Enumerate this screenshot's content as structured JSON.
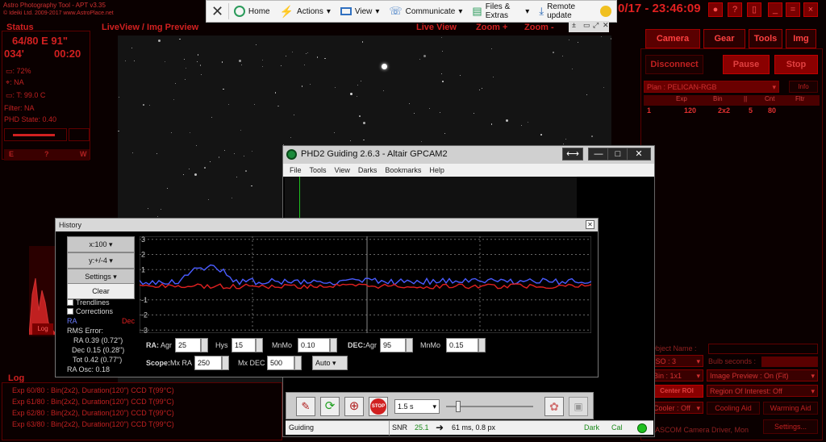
{
  "apt": {
    "title_line1": "Astro Photography Tool  -  APT v3.35",
    "title_line2": "© Ideiki Ltd. 2009-2017  www.AstroPlace.net",
    "clock": "0/17 - 23:46:09",
    "status": {
      "header": "Status",
      "exposure": "64/80 E  91\"",
      "angle": "034'",
      "time": "00:20",
      "battery": ": 72%",
      "focus": ": NA",
      "temp": ": T: 99.0 C",
      "filter": "Filter: NA",
      "phd_state": "PHD State: 0.40",
      "dir_e": "E",
      "dir_q": "?",
      "dir_w": "W"
    },
    "liveview": {
      "header": "LiveView / Img Preview",
      "live_view": "Live View",
      "zoom_in": "Zoom +",
      "zoom_out": "Zoom -"
    },
    "tabs": [
      "Camera",
      "Gear",
      "Tools",
      "Img"
    ],
    "buttons": {
      "disconnect": "Disconnect",
      "pause": "Pause",
      "stop": "Stop"
    },
    "plan": {
      "name": "Plan : PELICAN-RGB",
      "info": "Info",
      "headers": [
        "",
        "Exp",
        "Bin",
        "",
        "Cnt",
        "Fltr"
      ],
      "row": [
        "1",
        "120",
        "2x2",
        "5",
        "80",
        ""
      ]
    },
    "controls": {
      "object_name": "Object Name :",
      "bulb_seconds": "Bulb seconds :",
      "iso": "ISO : 3",
      "bin": "Bin : 1x1",
      "image_preview": "Image Preview : On (Fit)",
      "center_roi": "Center ROI",
      "roi": "Region Of Interest: Off",
      "cooler": "Cooler : Off",
      "cooling_aid": "Cooling Aid",
      "warming_aid": "Warming Aid",
      "driver": "ASCOM Camera Driver, Mon",
      "settings": "Settings..."
    },
    "histo_log": "Log",
    "log": {
      "header": "Log",
      "lines": [
        "Exp 60/80 : Bin(2x2), Duration(120\") CCD T(99°C)",
        "Exp 61/80 : Bin(2x2), Duration(120\") CCD T(99°C)",
        "Exp 62/80 : Bin(2x2), Duration(120\") CCD T(99°C)",
        "Exp 63/80 : Bin(2x2), Duration(120\") CCD T(99°C)"
      ]
    }
  },
  "toolbar": {
    "home": "Home",
    "actions": "Actions",
    "view": "View",
    "communicate": "Communicate",
    "files": "Files & Extras",
    "remote": "Remote update"
  },
  "phd": {
    "title": "PHD2 Guiding 2.6.3 - Altair GPCAM2",
    "menu": [
      "File",
      "Tools",
      "View",
      "Darks",
      "Bookmarks",
      "Help"
    ],
    "exposure": "1.5 s",
    "status": {
      "state": "Guiding",
      "snr_label": "SNR",
      "snr": "25.1",
      "info": "61 ms, 0.8 px",
      "dark": "Dark",
      "cal": "Cal"
    }
  },
  "history": {
    "title": "History",
    "x_scale": "x:100",
    "y_scale": "y:+/-4",
    "settings": "Settings",
    "clear": "Clear",
    "trendlines": "Trendlines",
    "corrections": "Corrections",
    "ra_label": "RA",
    "dec_label": "Dec",
    "rms_title": "RMS Error:",
    "rms_ra": "RA 0.39 (0.72\")",
    "rms_dec": "Dec 0.15 (0.28\")",
    "rms_tot": "Tot 0.42 (0.77\")",
    "ra_osc": "RA Osc: 0.18",
    "y_ticks": [
      "3",
      "2",
      "1",
      "",
      "-1",
      "-2",
      "-3"
    ],
    "ra": {
      "label": "RA:",
      "agr_label": "Agr",
      "agr": "25",
      "hys_label": "Hys",
      "hys": "15",
      "mnmo_label": "MnMo",
      "mnmo": "0.10"
    },
    "dec": {
      "label": "DEC:",
      "agr_label": "Agr",
      "agr": "95",
      "mnmo_label": "MnMo",
      "mnmo": "0.15"
    },
    "scope": {
      "label": "Scope:",
      "mxra_label": "Mx RA",
      "mxra": "250",
      "mxdec_label": "Mx DEC",
      "mxdec": "500",
      "mode": "Auto"
    },
    "colors": {
      "ra": "#4a5cff",
      "dec": "#e02020"
    }
  }
}
